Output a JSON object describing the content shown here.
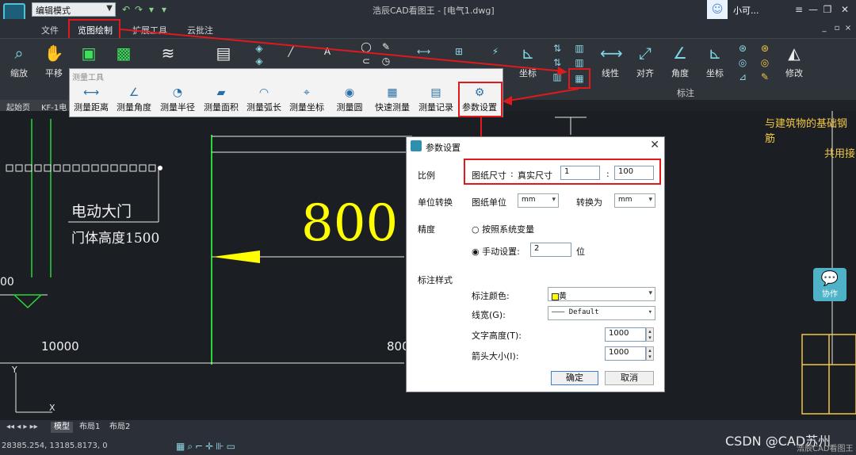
{
  "titlebar": {
    "mode_value": "编辑模式",
    "app_title": "浩辰CAD看图王 - [电气1.dwg]",
    "user_name": "小可..."
  },
  "menu": {
    "file": "文件",
    "view_draw": "览图绘制",
    "extend": "扩展工具",
    "cloud": "云批注"
  },
  "ribbon": {
    "buttons": [
      "缩放",
      "平移",
      "线性",
      "对齐",
      "角度",
      "坐标",
      "修改"
    ],
    "partial_label": "坐标",
    "group_label": "标注"
  },
  "doc_tabs": {
    "start": "起始页",
    "file": "KF-1电"
  },
  "measure_panel": {
    "title": "测量工具",
    "buttons": [
      "测量距离",
      "测量角度",
      "测量半径",
      "测量面积",
      "测量弧长",
      "测量坐标",
      "测量圆",
      "快速测量",
      "测量记录",
      "参数设置"
    ]
  },
  "drawing": {
    "text_door": "电动大门",
    "text_height": "门体高度1500",
    "text_800_big": "800",
    "text_10000": "10000",
    "text_800_small": "800",
    "text_right1": "与建筑物的基础钢筋",
    "text_right2": "共用接",
    "text_y": "Y",
    "text_x": "X",
    "text_left00": "00"
  },
  "dialog": {
    "title": "参数设置",
    "scale_label": "比例",
    "paper_size_label": "图纸尺寸",
    "colon": ":",
    "real_size_label": "真实尺寸",
    "paper_value": "1",
    "real_value": "100",
    "unit_label": "单位转换",
    "paper_unit_label": "图纸单位",
    "paper_unit_value": "mm",
    "convert_label": "转换为",
    "convert_value": "mm",
    "precision_label": "精度",
    "radio_system": "按照系统变量",
    "radio_manual": "手动设置:",
    "manual_value": "2",
    "digit_label": "位",
    "dim_style_label": "标注样式",
    "dim_color_label": "标注颜色:",
    "dim_color_value": "黄",
    "linewidth_label": "线宽(G):",
    "linewidth_value": "Default",
    "text_height_label": "文字高度(T):",
    "text_height_value": "1000",
    "arrow_size_label": "箭头大小(I):",
    "arrow_size_value": "1000",
    "ok": "确定",
    "cancel": "取消"
  },
  "collab": {
    "label": "协作"
  },
  "layout_tabs": [
    "模型",
    "布局1",
    "布局2"
  ],
  "status": {
    "coords": "28385.254, 13185.8173, 0",
    "watermark": "CSDN @CAD苏州",
    "app_watermark": "浩辰CAD看图王"
  },
  "colors": {
    "accent_red": "#e0191d",
    "cad_yellow": "#ffff00",
    "cad_green": "#2bd63a"
  }
}
